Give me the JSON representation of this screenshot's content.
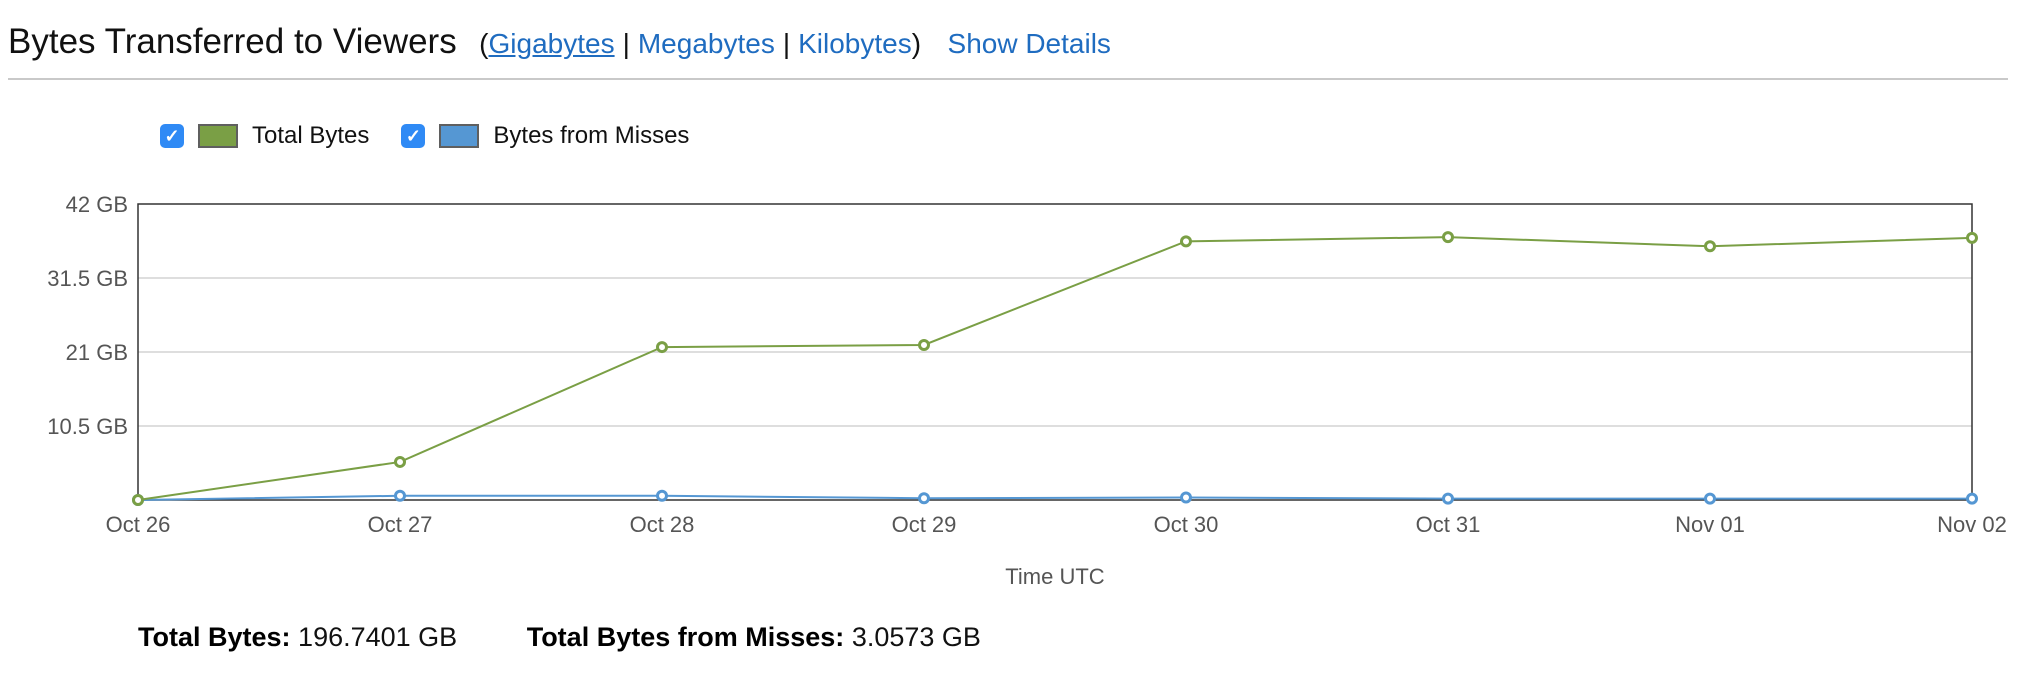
{
  "header": {
    "title": "Bytes Transferred to Viewers",
    "open_paren": "(",
    "close_paren": ")",
    "separator": "|",
    "units": [
      {
        "label": "Gigabytes",
        "active": true
      },
      {
        "label": "Megabytes",
        "active": false
      },
      {
        "label": "Kilobytes",
        "active": false
      }
    ],
    "show_details_label": "Show Details"
  },
  "legend": {
    "items": [
      {
        "label": "Total Bytes",
        "checked": true,
        "color": "#7a9f45"
      },
      {
        "label": "Bytes from Misses",
        "checked": true,
        "color": "#5597d3"
      }
    ],
    "check_glyph": "✓"
  },
  "chart_data": {
    "type": "line",
    "categories": [
      "Oct 26",
      "Oct 27",
      "Oct 28",
      "Oct 29",
      "Oct 30",
      "Oct 31",
      "Nov 01",
      "Nov 02"
    ],
    "series": [
      {
        "name": "Total Bytes",
        "color": "#7a9f45",
        "values": [
          0.0,
          5.4,
          21.7,
          22.0,
          36.7,
          37.3,
          36.0,
          37.2
        ]
      },
      {
        "name": "Bytes from Misses",
        "color": "#5597d3",
        "values": [
          0.0,
          0.6,
          0.6,
          0.25,
          0.35,
          0.2,
          0.2,
          0.2
        ]
      }
    ],
    "xlabel": "Time UTC",
    "ylabel": "",
    "yticks": [
      10.5,
      21,
      31.5,
      42
    ],
    "ytick_labels": [
      "10.5 GB",
      "21 GB",
      "31.5 GB",
      "42 GB"
    ],
    "ylim": [
      0,
      42
    ],
    "grid": true,
    "legend_position": "top-left"
  },
  "summary": {
    "total_label": "Total Bytes:",
    "total_value": "196.7401 GB",
    "misses_label": "Total Bytes from Misses:",
    "misses_value": "3.0573 GB"
  }
}
